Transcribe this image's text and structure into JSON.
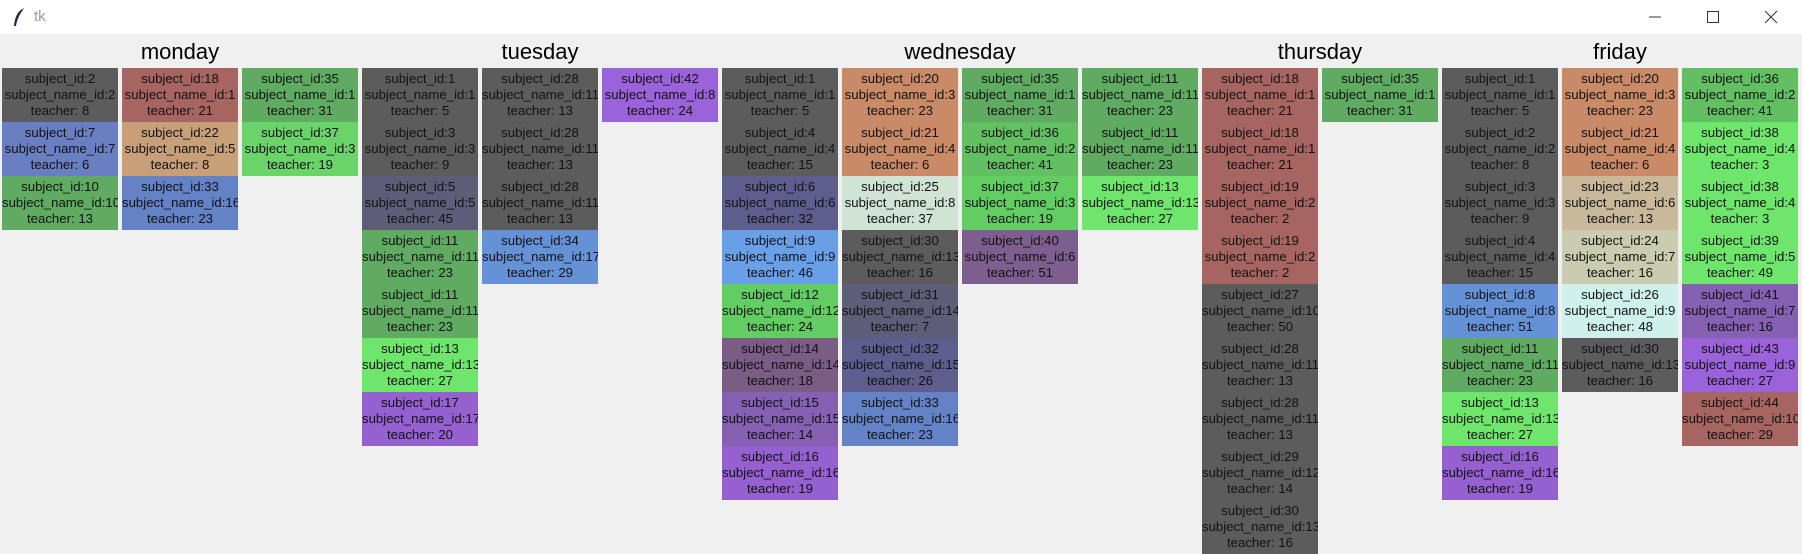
{
  "window": {
    "title": "tk",
    "icon": "feather-icon"
  },
  "controls": {
    "minimize": "minimize-icon",
    "maximize": "maximize-icon",
    "close": "close-icon"
  },
  "days": [
    {
      "name": "monday",
      "columns": [
        [
          {
            "subject": "subject_id:2",
            "subject_name": "subject_name_id:2",
            "teacher": "teacher: 8",
            "color": "#5c5c5c"
          },
          {
            "subject": "subject_id:7",
            "subject_name": "subject_name_id:7",
            "teacher": "teacher: 6",
            "color": "#6a7fc1"
          },
          {
            "subject": "subject_id:10",
            "subject_name": "subject_name_id:10",
            "teacher": "teacher: 13",
            "color": "#5fab62"
          }
        ],
        [
          {
            "subject": "subject_id:18",
            "subject_name": "subject_name_id:1",
            "teacher": "teacher: 21",
            "color": "#a76561"
          },
          {
            "subject": "subject_id:22",
            "subject_name": "subject_name_id:5",
            "teacher": "teacher: 8",
            "color": "#c7a07a"
          },
          {
            "subject": "subject_id:33",
            "subject_name": "subject_name_id:16",
            "teacher": "teacher: 23",
            "color": "#6482c6"
          }
        ],
        [
          {
            "subject": "subject_id:35",
            "subject_name": "subject_name_id:1",
            "teacher": "teacher: 31",
            "color": "#5fab62"
          },
          {
            "subject": "subject_id:37",
            "subject_name": "subject_name_id:3",
            "teacher": "teacher: 19",
            "color": "#6ad36a"
          }
        ]
      ]
    },
    {
      "name": "tuesday",
      "columns": [
        [
          {
            "subject": "subject_id:1",
            "subject_name": "subject_name_id:1",
            "teacher": "teacher: 5",
            "color": "#5c5c5c"
          },
          {
            "subject": "subject_id:3",
            "subject_name": "subject_name_id:3",
            "teacher": "teacher: 9",
            "color": "#5c5c5c"
          },
          {
            "subject": "subject_id:5",
            "subject_name": "subject_name_id:5",
            "teacher": "teacher: 45",
            "color": "#5e5e78"
          },
          {
            "subject": "subject_id:11",
            "subject_name": "subject_name_id:11",
            "teacher": "teacher: 23",
            "color": "#5fab62"
          },
          {
            "subject": "subject_id:11",
            "subject_name": "subject_name_id:11",
            "teacher": "teacher: 23",
            "color": "#5fab62"
          },
          {
            "subject": "subject_id:13",
            "subject_name": "subject_name_id:13",
            "teacher": "teacher: 27",
            "color": "#6de66b"
          },
          {
            "subject": "subject_id:17",
            "subject_name": "subject_name_id:17",
            "teacher": "teacher: 20",
            "color": "#9560cf"
          }
        ],
        [
          {
            "subject": "subject_id:28",
            "subject_name": "subject_name_id:11",
            "teacher": "teacher: 13",
            "color": "#5c5c5c"
          },
          {
            "subject": "subject_id:28",
            "subject_name": "subject_name_id:11",
            "teacher": "teacher: 13",
            "color": "#5c5c5c"
          },
          {
            "subject": "subject_id:28",
            "subject_name": "subject_name_id:11",
            "teacher": "teacher: 13",
            "color": "#5c5c5c"
          },
          {
            "subject": "subject_id:34",
            "subject_name": "subject_name_id:17",
            "teacher": "teacher: 29",
            "color": "#6592d6"
          }
        ],
        [
          {
            "subject": "subject_id:42",
            "subject_name": "subject_name_id:8",
            "teacher": "teacher: 24",
            "color": "#9a63d9"
          }
        ]
      ]
    },
    {
      "name": "wednesday",
      "columns": [
        [
          {
            "subject": "subject_id:1",
            "subject_name": "subject_name_id:1",
            "teacher": "teacher: 5",
            "color": "#5c5c5c"
          },
          {
            "subject": "subject_id:4",
            "subject_name": "subject_name_id:4",
            "teacher": "teacher: 15",
            "color": "#5c5c5c"
          },
          {
            "subject": "subject_id:6",
            "subject_name": "subject_name_id:6",
            "teacher": "teacher: 32",
            "color": "#5e5e8e"
          },
          {
            "subject": "subject_id:9",
            "subject_name": "subject_name_id:9",
            "teacher": "teacher: 46",
            "color": "#689fe7"
          },
          {
            "subject": "subject_id:12",
            "subject_name": "subject_name_id:12",
            "teacher": "teacher: 24",
            "color": "#62cd62"
          },
          {
            "subject": "subject_id:14",
            "subject_name": "subject_name_id:14",
            "teacher": "teacher: 18",
            "color": "#7a5c85"
          },
          {
            "subject": "subject_id:15",
            "subject_name": "subject_name_id:15",
            "teacher": "teacher: 14",
            "color": "#8660b2"
          },
          {
            "subject": "subject_id:16",
            "subject_name": "subject_name_id:16",
            "teacher": "teacher: 19",
            "color": "#9560cf"
          }
        ],
        [
          {
            "subject": "subject_id:20",
            "subject_name": "subject_name_id:3",
            "teacher": "teacher: 23",
            "color": "#c88a67"
          },
          {
            "subject": "subject_id:21",
            "subject_name": "subject_name_id:4",
            "teacher": "teacher: 6",
            "color": "#c88a67"
          },
          {
            "subject": "subject_id:25",
            "subject_name": "subject_name_id:8",
            "teacher": "teacher: 37",
            "color": "#cfe4d4"
          },
          {
            "subject": "subject_id:30",
            "subject_name": "subject_name_id:13",
            "teacher": "teacher: 16",
            "color": "#5c5c5c"
          },
          {
            "subject": "subject_id:31",
            "subject_name": "subject_name_id:14",
            "teacher": "teacher: 7",
            "color": "#5e5e78"
          },
          {
            "subject": "subject_id:32",
            "subject_name": "subject_name_id:15",
            "teacher": "teacher: 26",
            "color": "#5e5e8e"
          },
          {
            "subject": "subject_id:33",
            "subject_name": "subject_name_id:16",
            "teacher": "teacher: 23",
            "color": "#6482c6"
          }
        ],
        [
          {
            "subject": "subject_id:35",
            "subject_name": "subject_name_id:1",
            "teacher": "teacher: 31",
            "color": "#5fab62"
          },
          {
            "subject": "subject_id:36",
            "subject_name": "subject_name_id:2",
            "teacher": "teacher: 41",
            "color": "#62bf62"
          },
          {
            "subject": "subject_id:37",
            "subject_name": "subject_name_id:3",
            "teacher": "teacher: 19",
            "color": "#62cd62"
          },
          {
            "subject": "subject_id:40",
            "subject_name": "subject_name_id:6",
            "teacher": "teacher: 51",
            "color": "#7e5e8e"
          }
        ],
        [
          {
            "subject": "subject_id:11",
            "subject_name": "subject_name_id:11",
            "teacher": "teacher: 23",
            "color": "#5fab62"
          },
          {
            "subject": "subject_id:11",
            "subject_name": "subject_name_id:11",
            "teacher": "teacher: 23",
            "color": "#5fab62"
          },
          {
            "subject": "subject_id:13",
            "subject_name": "subject_name_id:13",
            "teacher": "teacher: 27",
            "color": "#6de66b"
          }
        ]
      ]
    },
    {
      "name": "thursday",
      "columns": [
        [
          {
            "subject": "subject_id:18",
            "subject_name": "subject_name_id:1",
            "teacher": "teacher: 21",
            "color": "#a76561"
          },
          {
            "subject": "subject_id:18",
            "subject_name": "subject_name_id:1",
            "teacher": "teacher: 21",
            "color": "#a76561"
          },
          {
            "subject": "subject_id:19",
            "subject_name": "subject_name_id:2",
            "teacher": "teacher: 2",
            "color": "#a76561"
          },
          {
            "subject": "subject_id:19",
            "subject_name": "subject_name_id:2",
            "teacher": "teacher: 2",
            "color": "#a76561"
          },
          {
            "subject": "subject_id:27",
            "subject_name": "subject_name_id:10",
            "teacher": "teacher: 50",
            "color": "#5c5c5c"
          },
          {
            "subject": "subject_id:28",
            "subject_name": "subject_name_id:11",
            "teacher": "teacher: 13",
            "color": "#5c5c5c"
          },
          {
            "subject": "subject_id:28",
            "subject_name": "subject_name_id:11",
            "teacher": "teacher: 13",
            "color": "#5c5c5c"
          },
          {
            "subject": "subject_id:29",
            "subject_name": "subject_name_id:12",
            "teacher": "teacher: 14",
            "color": "#5c5c5c"
          },
          {
            "subject": "subject_id:30",
            "subject_name": "subject_name_id:13",
            "teacher": "teacher: 16",
            "color": "#5c5c5c"
          }
        ],
        [
          {
            "subject": "subject_id:35",
            "subject_name": "subject_name_id:1",
            "teacher": "teacher: 31",
            "color": "#5fab62"
          }
        ]
      ]
    },
    {
      "name": "friday",
      "columns": [
        [
          {
            "subject": "subject_id:1",
            "subject_name": "subject_name_id:1",
            "teacher": "teacher: 5",
            "color": "#5c5c5c"
          },
          {
            "subject": "subject_id:2",
            "subject_name": "subject_name_id:2",
            "teacher": "teacher: 8",
            "color": "#5c5c5c"
          },
          {
            "subject": "subject_id:3",
            "subject_name": "subject_name_id:3",
            "teacher": "teacher: 9",
            "color": "#5c5c5c"
          },
          {
            "subject": "subject_id:4",
            "subject_name": "subject_name_id:4",
            "teacher": "teacher: 15",
            "color": "#5c5c5c"
          },
          {
            "subject": "subject_id:8",
            "subject_name": "subject_name_id:8",
            "teacher": "teacher: 51",
            "color": "#6592d6"
          },
          {
            "subject": "subject_id:11",
            "subject_name": "subject_name_id:11",
            "teacher": "teacher: 23",
            "color": "#5fab62"
          },
          {
            "subject": "subject_id:13",
            "subject_name": "subject_name_id:13",
            "teacher": "teacher: 27",
            "color": "#6de66b"
          },
          {
            "subject": "subject_id:16",
            "subject_name": "subject_name_id:16",
            "teacher": "teacher: 19",
            "color": "#9560cf"
          }
        ],
        [
          {
            "subject": "subject_id:20",
            "subject_name": "subject_name_id:3",
            "teacher": "teacher: 23",
            "color": "#c88a67"
          },
          {
            "subject": "subject_id:21",
            "subject_name": "subject_name_id:4",
            "teacher": "teacher: 6",
            "color": "#c88a67"
          },
          {
            "subject": "subject_id:23",
            "subject_name": "subject_name_id:6",
            "teacher": "teacher: 13",
            "color": "#c9b99a"
          },
          {
            "subject": "subject_id:24",
            "subject_name": "subject_name_id:7",
            "teacher": "teacher: 16",
            "color": "#c9ccaf"
          },
          {
            "subject": "subject_id:26",
            "subject_name": "subject_name_id:9",
            "teacher": "teacher: 48",
            "color": "#cef1ec"
          },
          {
            "subject": "subject_id:30",
            "subject_name": "subject_name_id:13",
            "teacher": "teacher: 16",
            "color": "#5c5c5c"
          }
        ],
        [
          {
            "subject": "subject_id:36",
            "subject_name": "subject_name_id:2",
            "teacher": "teacher: 41",
            "color": "#62bf62"
          },
          {
            "subject": "subject_id:38",
            "subject_name": "subject_name_id:4",
            "teacher": "teacher: 3",
            "color": "#6de66b"
          },
          {
            "subject": "subject_id:38",
            "subject_name": "subject_name_id:4",
            "teacher": "teacher: 3",
            "color": "#6de66b"
          },
          {
            "subject": "subject_id:39",
            "subject_name": "subject_name_id:5",
            "teacher": "teacher: 49",
            "color": "#6de66b"
          },
          {
            "subject": "subject_id:41",
            "subject_name": "subject_name_id:7",
            "teacher": "teacher: 16",
            "color": "#8660b2"
          },
          {
            "subject": "subject_id:43",
            "subject_name": "subject_name_id:9",
            "teacher": "teacher: 27",
            "color": "#9a63d9"
          },
          {
            "subject": "subject_id:44",
            "subject_name": "subject_name_id:10",
            "teacher": "teacher: 29",
            "color": "#a76561"
          }
        ]
      ]
    }
  ]
}
